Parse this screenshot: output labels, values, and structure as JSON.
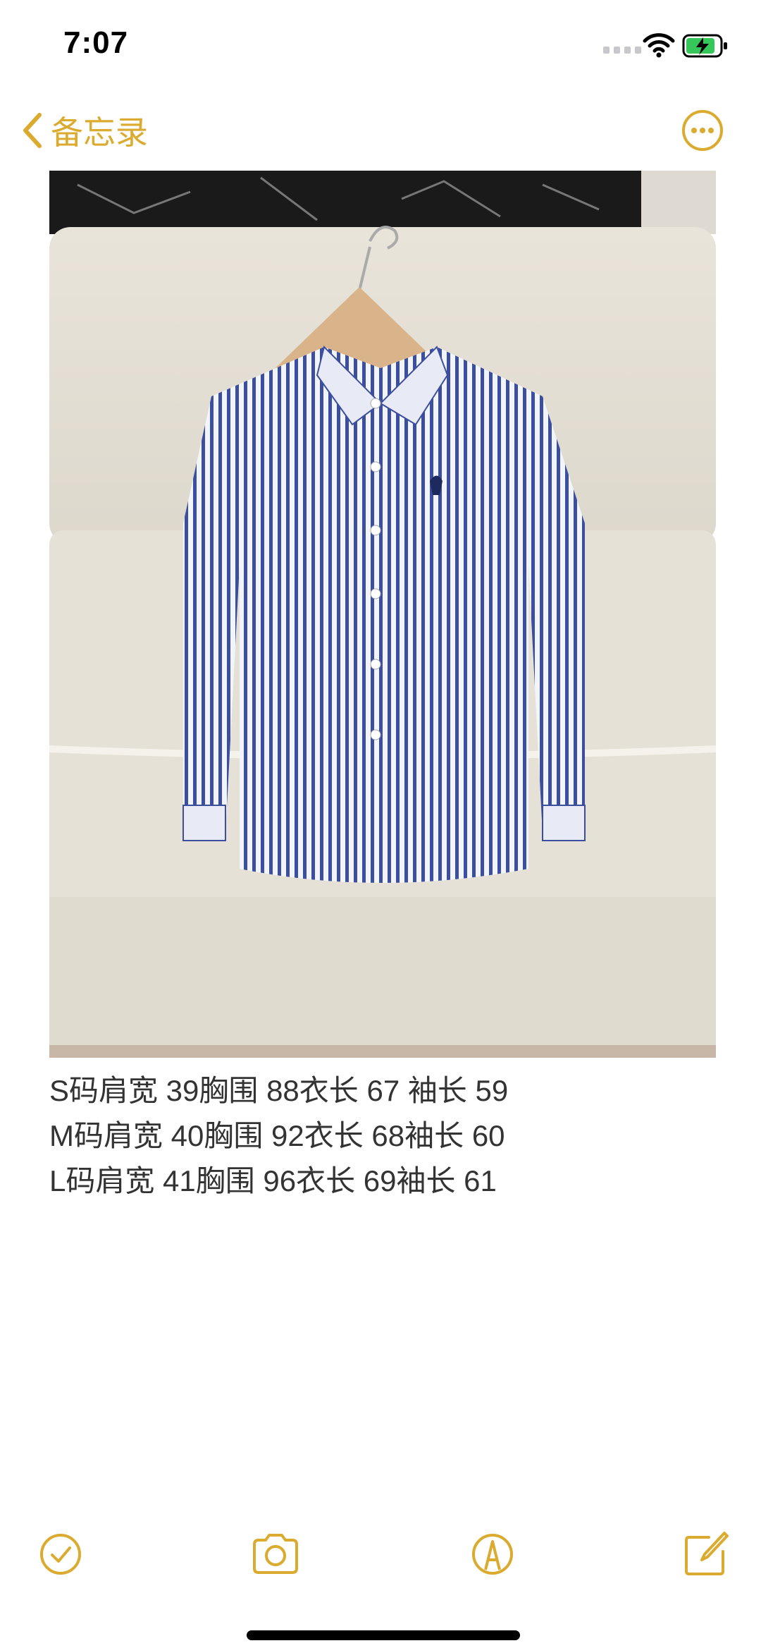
{
  "status_bar": {
    "time": "7:07",
    "wifi_icon": "wifi-icon",
    "battery_icon": "battery-charging-icon"
  },
  "nav": {
    "back_label": "备忘录",
    "back_icon": "chevron-left-icon",
    "more_icon": "ellipsis-circle-icon"
  },
  "note": {
    "image_description_icon": "shirt-photo",
    "lines": [
      "S码肩宽 39胸围 88衣长 67 袖长 59",
      "M码肩宽 40胸围 92衣长 68袖长 60",
      "L码肩宽 41胸围 96衣长 69袖长 61"
    ]
  },
  "toolbar": {
    "items": [
      "checklist-icon",
      "camera-icon",
      "markup-icon",
      "compose-icon"
    ]
  },
  "colors": {
    "accent": "#dbab2f",
    "text": "#333333"
  }
}
